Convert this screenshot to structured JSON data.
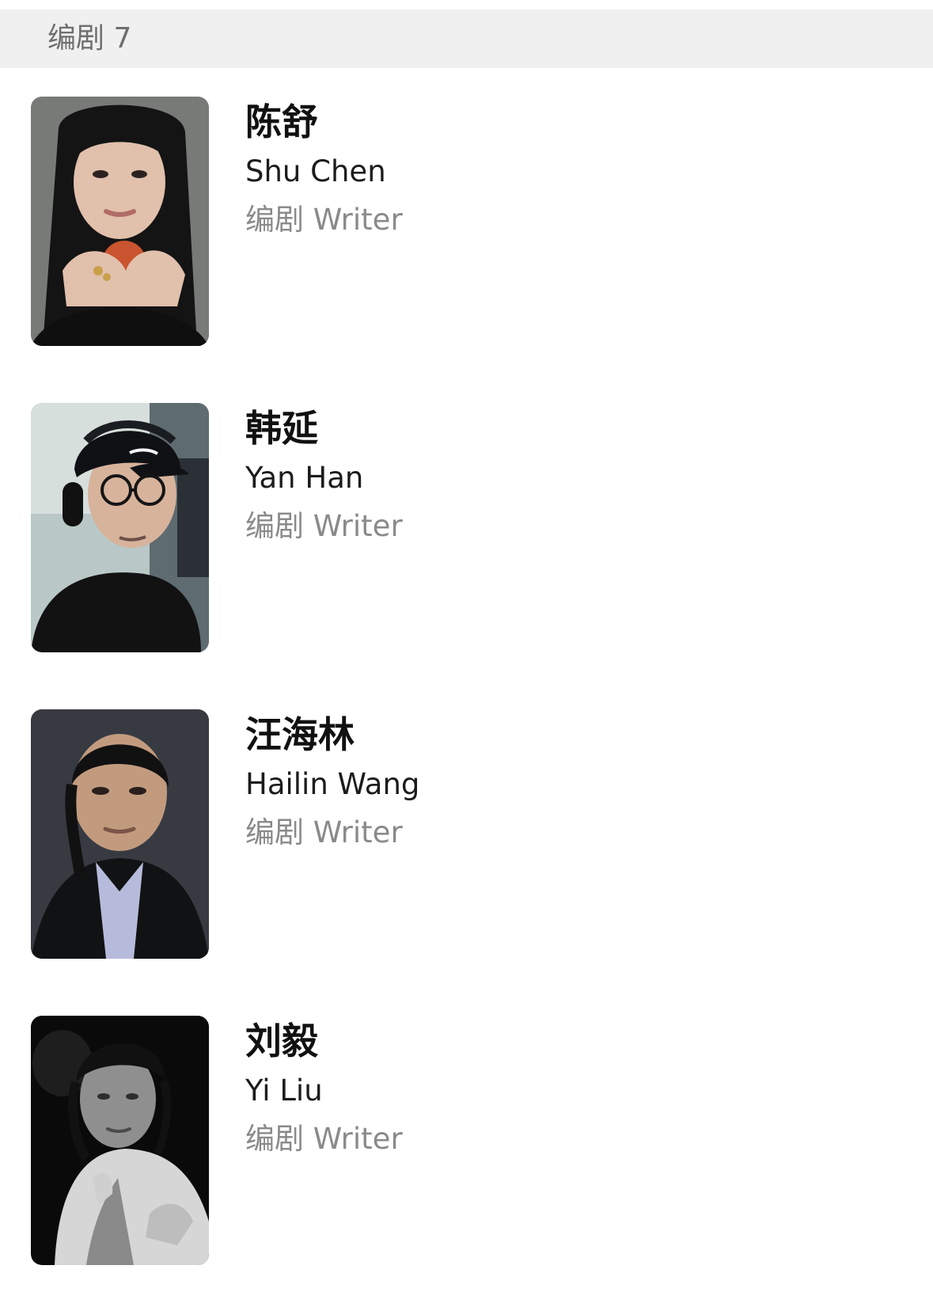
{
  "section": {
    "title": "编剧 7"
  },
  "people": [
    {
      "name_zh": "陈舒",
      "name_en": "Shu Chen",
      "role": "编剧 Writer",
      "photo_icon": "portrait-woman-long-hair"
    },
    {
      "name_zh": "韩延",
      "name_en": "Yan Han",
      "role": "编剧 Writer",
      "photo_icon": "portrait-man-cap-headphones"
    },
    {
      "name_zh": "汪海林",
      "name_en": "Hailin Wang",
      "role": "编剧 Writer",
      "photo_icon": "portrait-man-suit"
    },
    {
      "name_zh": "刘毅",
      "name_en": "Yi Liu",
      "role": "编剧 Writer",
      "photo_icon": "portrait-man-black-white"
    }
  ],
  "colors": {
    "header_bg": "#f0f0f0",
    "header_text": "#6f6f6f",
    "name_primary": "#111111",
    "role_text": "#8a8a8a"
  }
}
